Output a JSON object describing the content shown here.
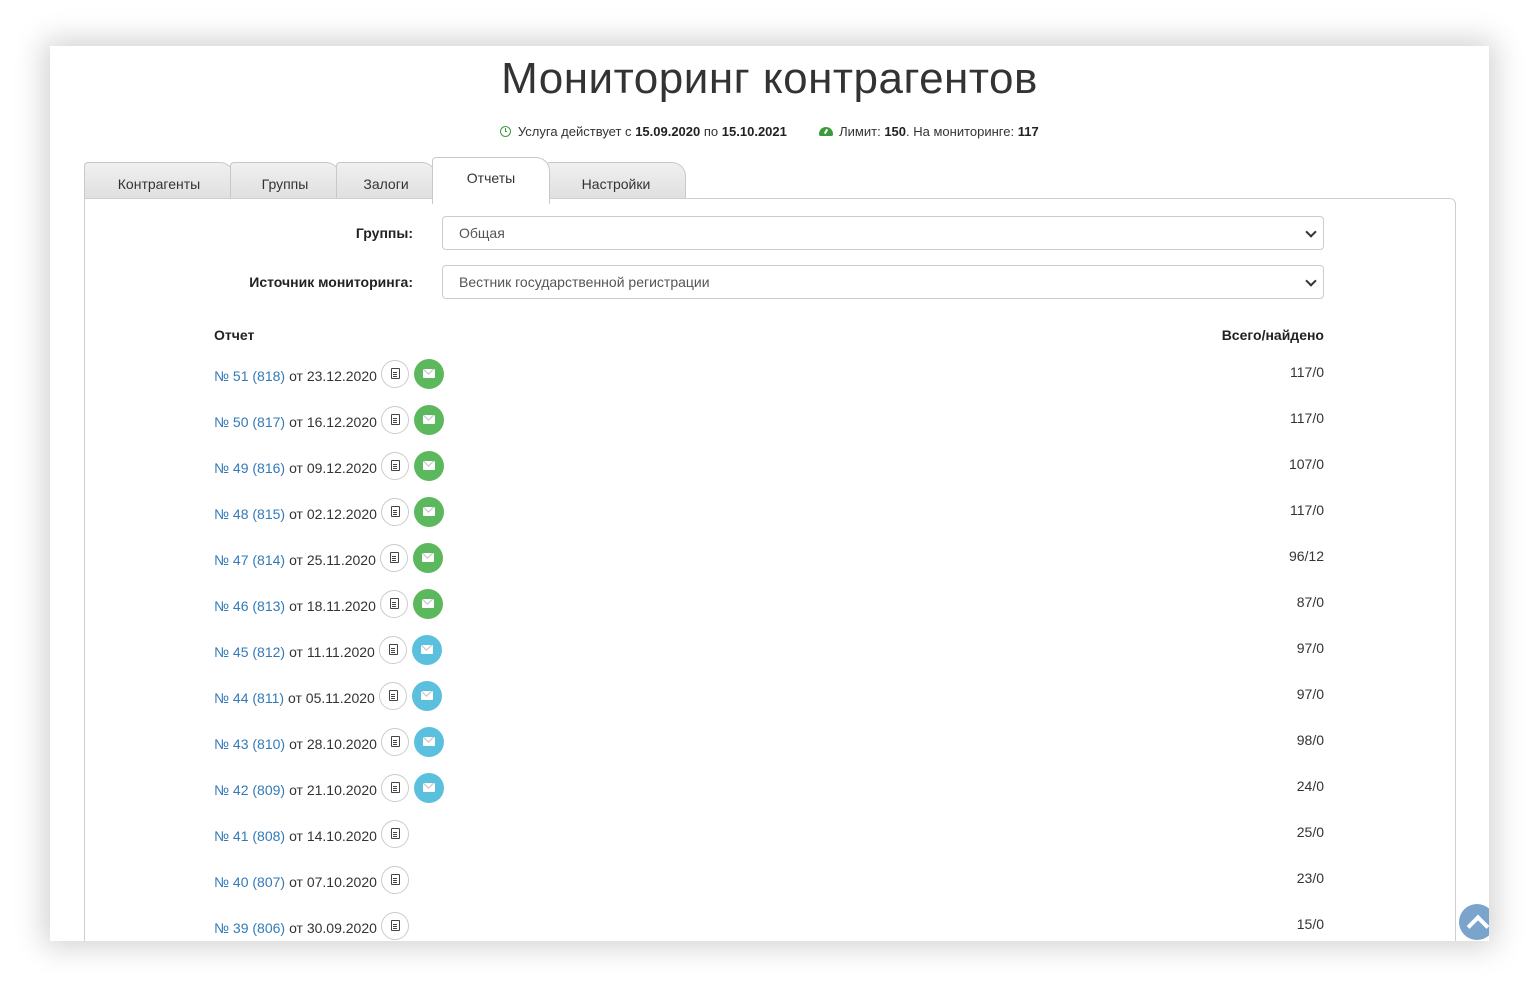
{
  "page_title": "Мониторинг контрагентов",
  "service": {
    "prefix": "Услуга действует с",
    "from": "15.09.2020",
    "by": "по",
    "to": "15.10.2021",
    "limit_label": "Лимит:",
    "limit_value": "150",
    "monitoring_label": ". На мониторинге:",
    "monitoring_value": "117"
  },
  "tabs": [
    {
      "label": "Контрагенты"
    },
    {
      "label": "Группы"
    },
    {
      "label": "Залоги"
    },
    {
      "label": "Отчеты",
      "active": true
    },
    {
      "label": "Настройки"
    }
  ],
  "filters": {
    "groups_label": "Группы:",
    "groups_value": "Общая",
    "source_label": "Источник мониторинга:",
    "source_value": "Вестник государственной регистрации"
  },
  "list_header": {
    "report": "Отчет",
    "total_found": "Всего/найдено"
  },
  "reports": [
    {
      "link": "№ 51 (818)",
      "date": "от 23.12.2020",
      "mail": "green",
      "count": "117/0"
    },
    {
      "link": "№ 50 (817)",
      "date": "от 16.12.2020",
      "mail": "green",
      "count": "117/0"
    },
    {
      "link": "№ 49 (816)",
      "date": "от 09.12.2020",
      "mail": "green",
      "count": "107/0"
    },
    {
      "link": "№ 48 (815)",
      "date": "от 02.12.2020",
      "mail": "green",
      "count": "117/0"
    },
    {
      "link": "№ 47 (814)",
      "date": "от 25.11.2020",
      "mail": "green",
      "count": "96/12"
    },
    {
      "link": "№ 46 (813)",
      "date": "от 18.11.2020",
      "mail": "green",
      "count": "87/0"
    },
    {
      "link": "№ 45 (812)",
      "date": "от 11.11.2020",
      "mail": "blue",
      "count": "97/0"
    },
    {
      "link": "№ 44 (811)",
      "date": "от 05.11.2020",
      "mail": "blue",
      "count": "97/0"
    },
    {
      "link": "№ 43 (810)",
      "date": "от 28.10.2020",
      "mail": "blue",
      "count": "98/0"
    },
    {
      "link": "№ 42 (809)",
      "date": "от 21.10.2020",
      "mail": "blue",
      "count": "24/0"
    },
    {
      "link": "№ 41 (808)",
      "date": "от 14.10.2020",
      "mail": "none",
      "count": "25/0"
    },
    {
      "link": "№ 40 (807)",
      "date": "от 07.10.2020",
      "mail": "none",
      "count": "23/0"
    },
    {
      "link": "№ 39 (806)",
      "date": "от 30.09.2020",
      "mail": "none",
      "count": "15/0"
    }
  ],
  "colors": {
    "link": "#337ab7",
    "mail_green": "#5cb85c",
    "mail_blue": "#5bc0de",
    "icon_green": "#3c9a3c"
  }
}
